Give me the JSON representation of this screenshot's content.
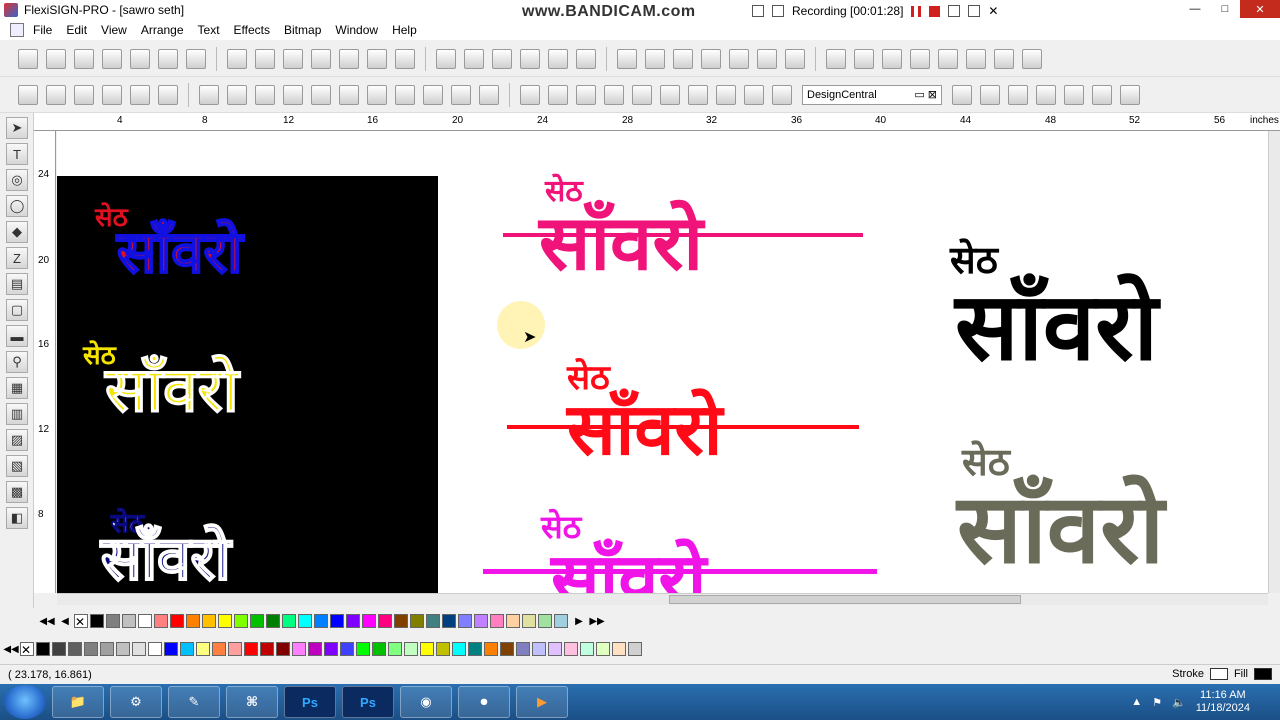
{
  "window": {
    "title": "FlexiSIGN-PRO - [sawro seth]",
    "minimize": "—",
    "maximize": "□",
    "close": "✕"
  },
  "recorder": {
    "watermark": "www.BANDICAM.com",
    "status": "Recording [00:01:28]"
  },
  "menu": [
    "File",
    "Edit",
    "View",
    "Arrange",
    "Text",
    "Effects",
    "Bitmap",
    "Window",
    "Help"
  ],
  "toolbar": {
    "design_central_label": "DesignCentral"
  },
  "ruler": {
    "horizontal_ticks": [
      "4",
      "8",
      "12",
      "16",
      "20",
      "24",
      "28",
      "32",
      "36",
      "40",
      "44",
      "48",
      "52",
      "56",
      "inches"
    ],
    "vertical_ticks": [
      "24",
      "20",
      "16",
      "12",
      "8"
    ]
  },
  "artwork": {
    "seth": "सेठ",
    "sanwro": "साँवरो",
    "colors": {
      "blue": "#1010e0",
      "red": "#e01020",
      "yellow": "#f5e400",
      "white": "#ffffff",
      "navy": "#0a0a80",
      "pink": "#f0137a",
      "bright_red": "#ff0a16",
      "magenta": "#f014e8",
      "black": "#000000",
      "olive_gray": "#6b6b5a"
    }
  },
  "palette_row1": [
    "#000000",
    "#7f7f7f",
    "#c0c0c0",
    "#ffffff",
    "#ff8080",
    "#ff0000",
    "#ff8000",
    "#ffc000",
    "#ffff00",
    "#80ff00",
    "#00c000",
    "#008000",
    "#00ff80",
    "#00ffff",
    "#0080ff",
    "#0000ff",
    "#8000ff",
    "#ff00ff",
    "#ff0080",
    "#804000",
    "#808000",
    "#408080",
    "#004080",
    "#8080ff",
    "#c080ff",
    "#ff80c0",
    "#ffd0a0",
    "#e0e0a0",
    "#a0e0a0",
    "#a0d0e0"
  ],
  "palette_row2": [
    "#000000",
    "#404040",
    "#606060",
    "#808080",
    "#a0a0a0",
    "#c0c0c0",
    "#e0e0e0",
    "#ffffff",
    "#0000ff",
    "#00c0ff",
    "#ffff80",
    "#ff8040",
    "#ffa0a0",
    "#ff0000",
    "#c00000",
    "#800000",
    "#ff80ff",
    "#c000c0",
    "#8000ff",
    "#4040ff",
    "#00ff00",
    "#00c000",
    "#80ff80",
    "#c0ffc0",
    "#ffff00",
    "#c0c000",
    "#00ffff",
    "#008080",
    "#ff8000",
    "#804000",
    "#8080c0",
    "#c0c0ff",
    "#e0c0ff",
    "#ffc0e0",
    "#c0ffe0",
    "#e0ffc0",
    "#ffe0c0",
    "#d0d0d0"
  ],
  "status": {
    "coords": "(  23.178,     16.861)",
    "stroke_label": "Stroke",
    "fill_label": "Fill"
  },
  "taskbar": {
    "apps": [
      "Explorer",
      "Bin",
      "FlexiSIGN",
      "Sign",
      "Ps",
      "Ps",
      "Chrome",
      "Rec",
      "Video"
    ],
    "time": "11:16 AM",
    "date": "11/18/2024"
  }
}
